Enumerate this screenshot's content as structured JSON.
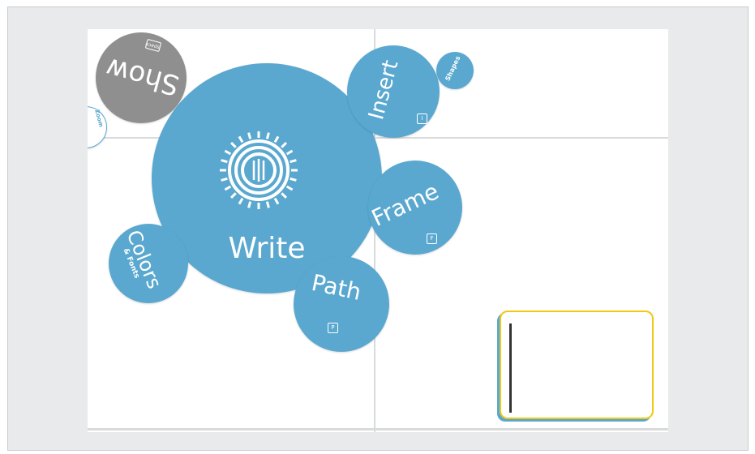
{
  "menu": {
    "center_label": "Write",
    "items": {
      "insert": {
        "label": "Insert",
        "key": "I"
      },
      "shapes": {
        "label": "Shapes"
      },
      "frame": {
        "label": "Frame",
        "key": "F"
      },
      "path": {
        "label": "Path",
        "key": "P"
      },
      "colors": {
        "label": "Colors",
        "sub": "& Fonts"
      },
      "show": {
        "label": "Show",
        "key": "space"
      },
      "partial": {
        "label": "Zoom"
      }
    }
  },
  "colors": {
    "bubble": "#5aa8cf",
    "show_bubble": "#8f8f8f",
    "textbox_border": "#f2c811",
    "canvas": "#ffffff",
    "frame_background": "#e9eaeb"
  },
  "icons": [
    "prezi-logo-icon",
    "keyboard-key-icon",
    "text-caret"
  ]
}
